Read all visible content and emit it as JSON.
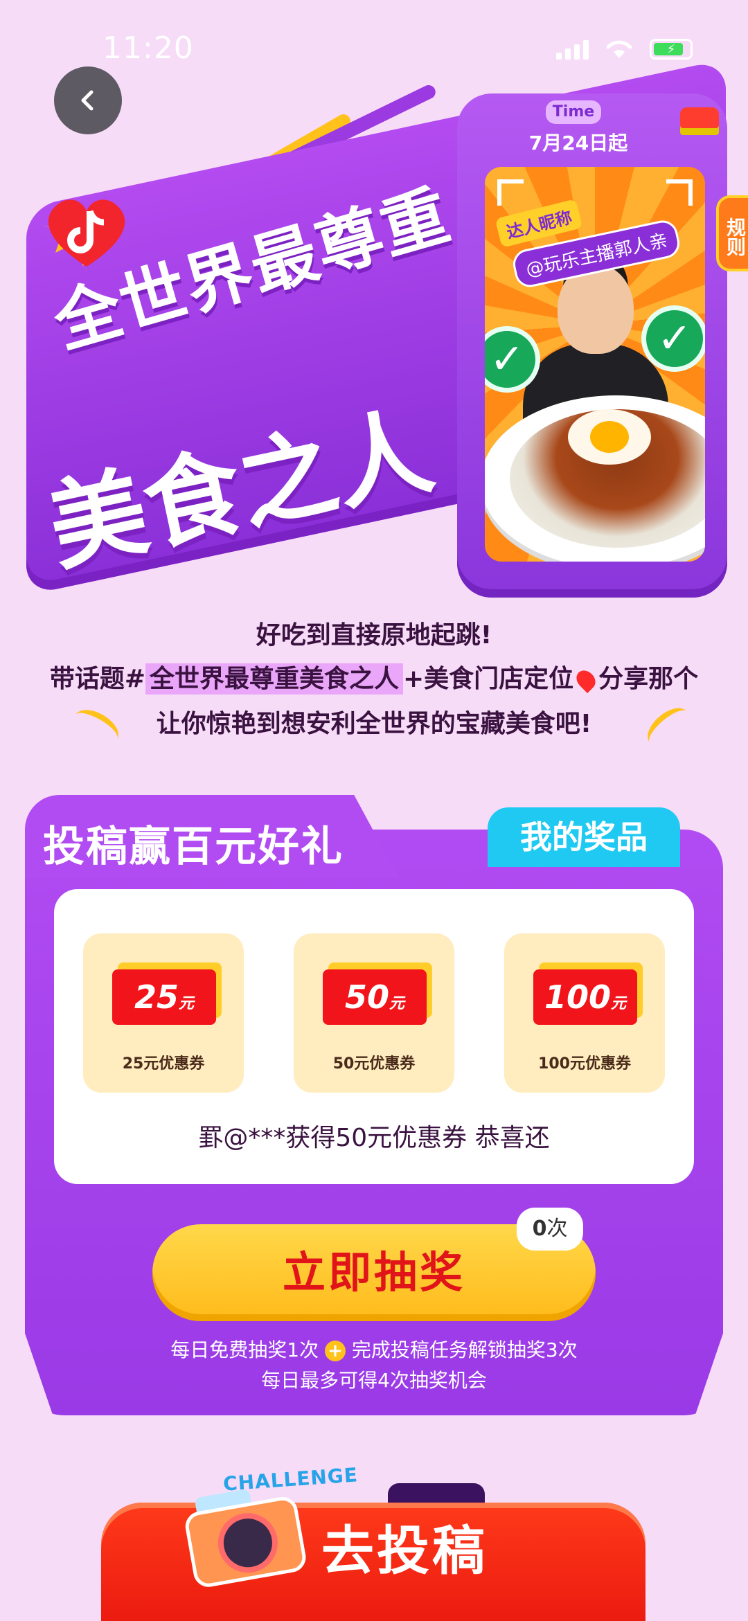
{
  "status_bar": {
    "time": "11:20"
  },
  "hero": {
    "time_badge": "Time",
    "start_date": "7月24日起",
    "nick_tag": "达人昵称",
    "nick_name": "@玩乐主播郭人亲",
    "title_line1": "全世界最尊重",
    "title_line2": "美食之人",
    "rules_tab": "规则"
  },
  "intro": {
    "line1": "好吃到直接原地起跳!",
    "line2_prefix": "带话题#",
    "hashtag": "全世界最尊重美食之人",
    "line2_mid": "+美食门店定位",
    "line2_suffix": "分享那个",
    "line3": "让你惊艳到想安利全世界的宝藏美食吧!"
  },
  "prize": {
    "title": "投稿赢百元好礼",
    "my_prizes": "我的奖品",
    "coupons": [
      {
        "amount": "25",
        "unit": "元",
        "label": "25元优惠券"
      },
      {
        "amount": "50",
        "unit": "元",
        "label": "50元优惠券"
      },
      {
        "amount": "100",
        "unit": "元",
        "label": "100元优惠券"
      }
    ],
    "marquee": "罫@***获得50元优惠券   恭喜还",
    "draw_button": "立即抽奖",
    "draw_count": "0",
    "draw_count_unit": "次",
    "note_line1_a": "每日免费抽奖1次",
    "note_line1_b": "完成投稿任务解锁抽奖3次",
    "note_line2": "每日最多可得4次抽奖机会"
  },
  "bottom": {
    "challenge": "CHALLENGE",
    "submit_button": "去投稿"
  },
  "colors": {
    "background": "#f7dcf8",
    "purple": "#9a3ae6",
    "yellow": "#ffc21a",
    "red": "#e8160e",
    "cyan": "#1fc9f2"
  }
}
